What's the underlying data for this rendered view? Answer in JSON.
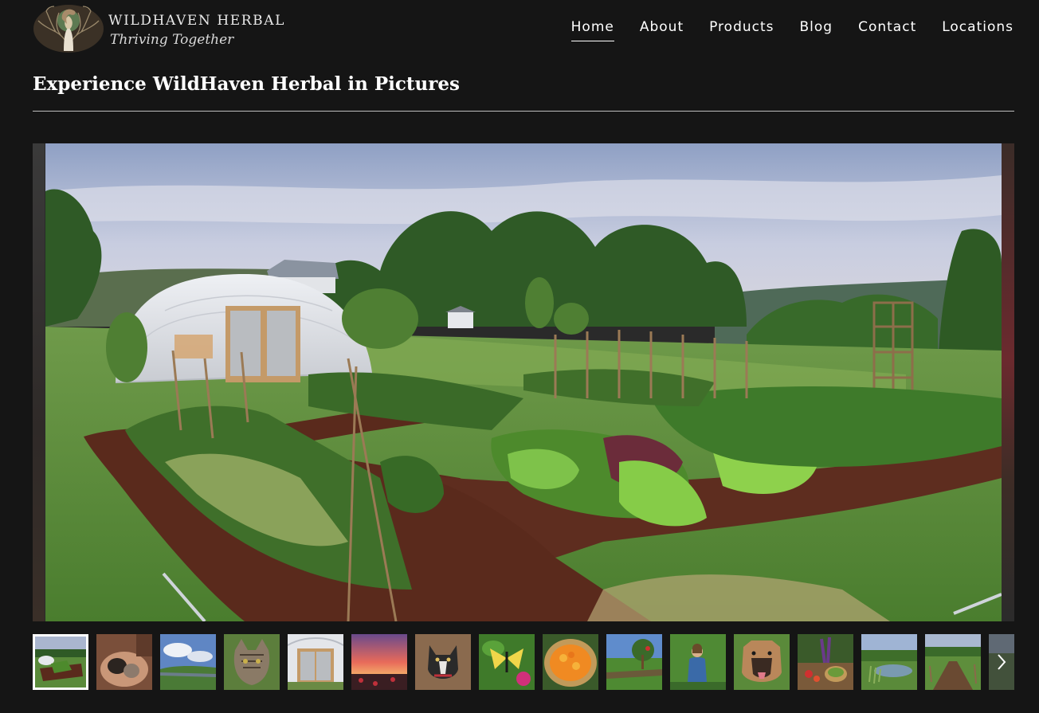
{
  "brand": {
    "name": "WILDHAVEN HERBAL",
    "tagline": "Thriving Together",
    "logo_icon": "tree-woman-logo-icon"
  },
  "nav": {
    "items": [
      {
        "label": "Home",
        "active": true
      },
      {
        "label": "About",
        "active": false
      },
      {
        "label": "Products",
        "active": false
      },
      {
        "label": "Blog",
        "active": false
      },
      {
        "label": "Contact",
        "active": false
      },
      {
        "label": "Locations",
        "active": false
      }
    ]
  },
  "gallery": {
    "title": "Experience WildHaven Herbal in Pictures",
    "main_image": "garden-greenhouse-photo",
    "selected_index": 0,
    "thumbnails": [
      "garden-beds",
      "chicks-in-hands",
      "hilltop-sky",
      "tabby-cat",
      "greenhouse-doors",
      "sunset-field",
      "small-dog",
      "swallowtail-butterfly",
      "calendula-basket",
      "orchard-row",
      "woman-in-garden",
      "mastiff-dog",
      "harvest-table",
      "pond-meadow",
      "garden-path",
      "forest-edge"
    ],
    "next_icon": "chevron-right-icon"
  },
  "colors": {
    "background": "#151515",
    "text": "#ffffff",
    "rule": "#bdbdbd"
  }
}
